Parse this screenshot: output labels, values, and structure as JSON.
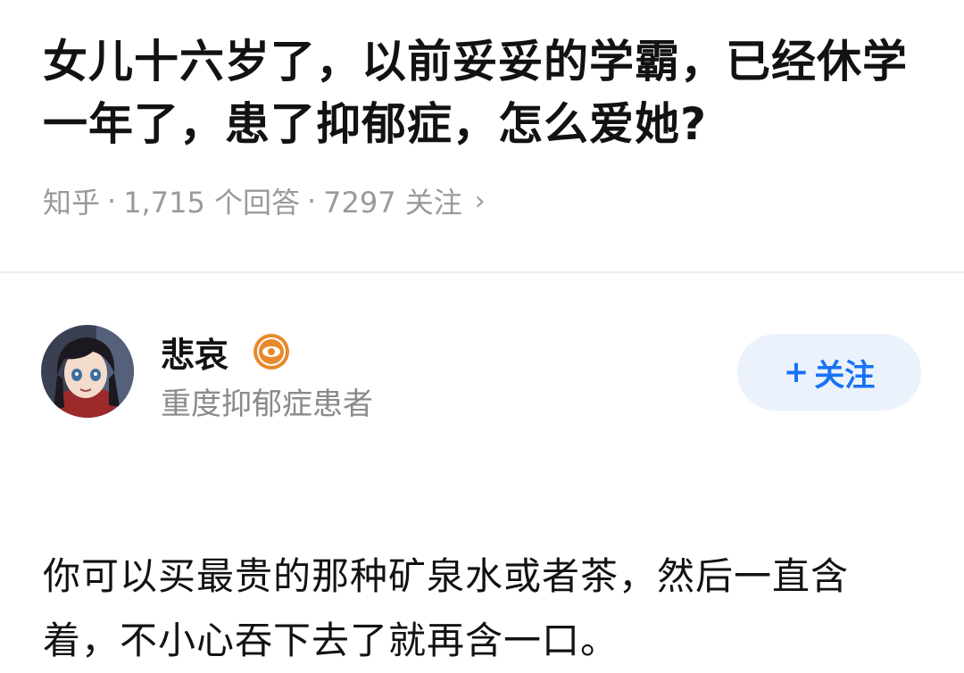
{
  "question": {
    "title": "女儿十六岁了，以前妥妥的学霸，已经休学一年了，患了抑郁症，怎么爱她?",
    "source": "知乎",
    "answer_count": "1,715 个回答",
    "follow_count": "7297 关注"
  },
  "author": {
    "name": "悲哀",
    "bio": "重度抑郁症患者",
    "follow_label": "关注",
    "badge_icon": "eye-badge-icon",
    "badge_color": "#e8892b"
  },
  "answer": {
    "text": "你可以买最贵的那种矿泉水或者茶，然后一直含着，不小心吞下去了就再含一口。"
  },
  "colors": {
    "accent": "#1772f6",
    "follow_bg": "#ebf2fc",
    "meta_text": "#9a9a9a"
  }
}
